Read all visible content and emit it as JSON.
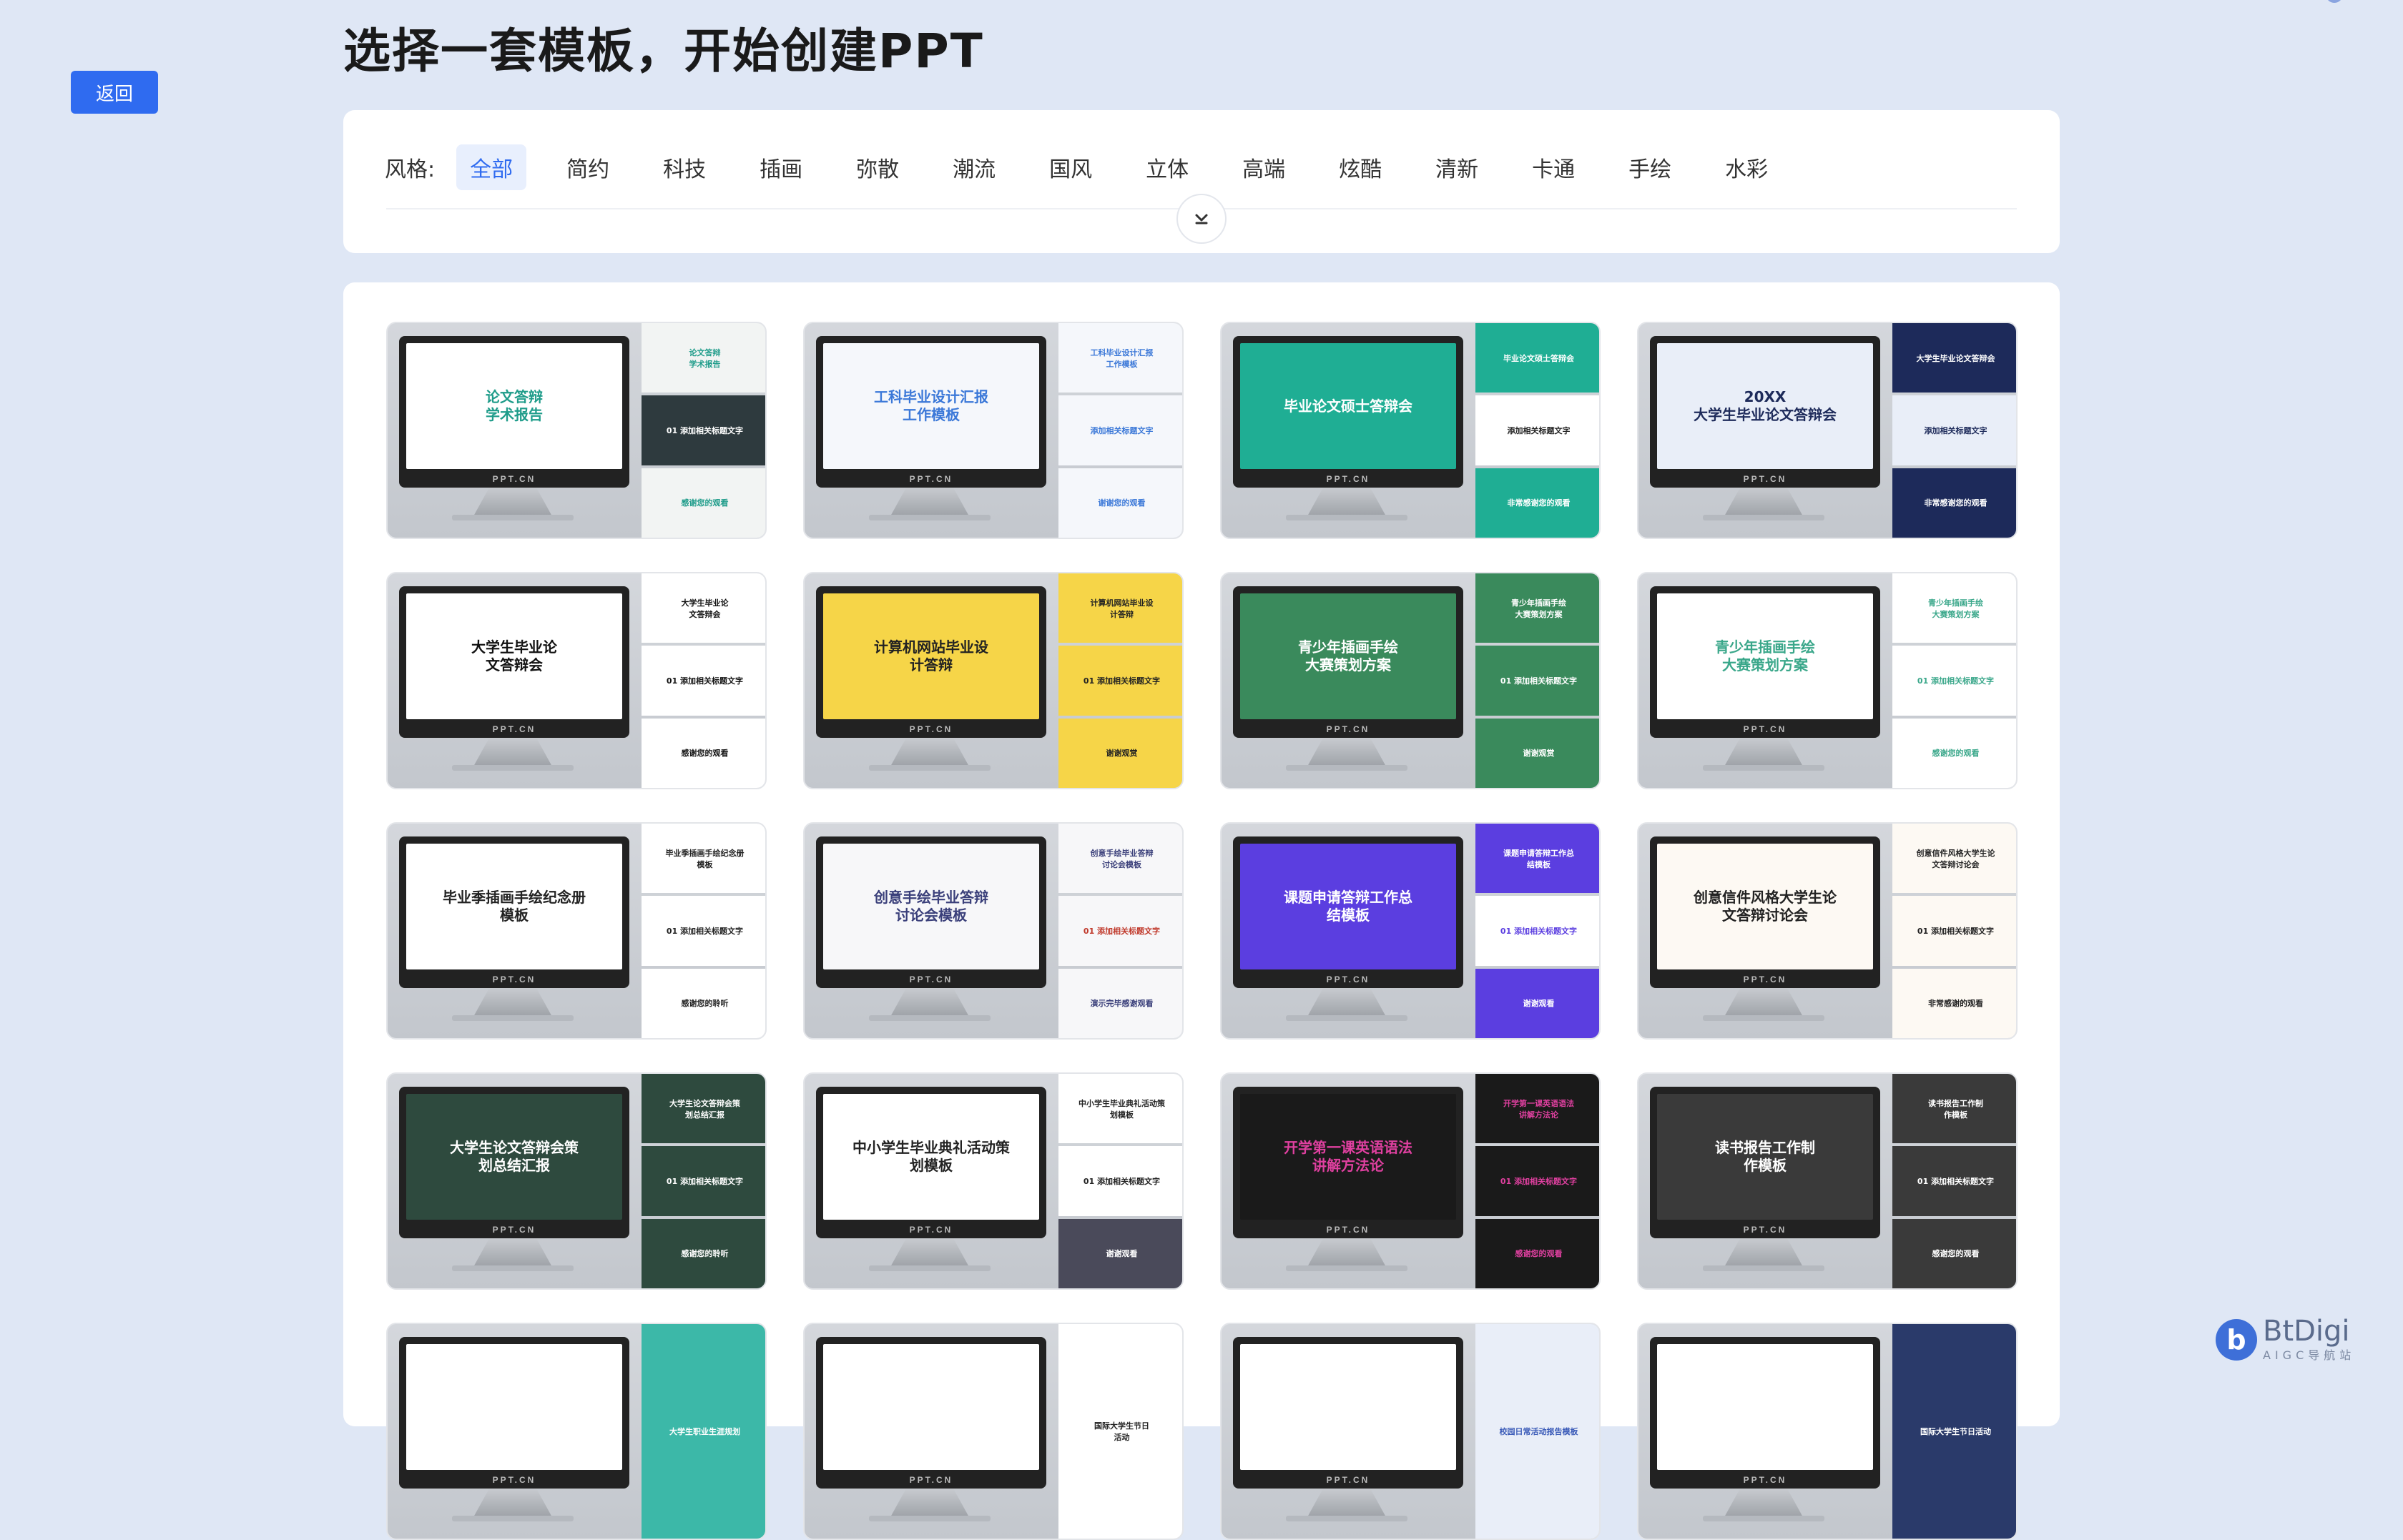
{
  "back_button": "返回",
  "page_title": "选择一套模板，开始创建PPT",
  "filter": {
    "label": "风格:",
    "active": "全部",
    "tags": [
      "全部",
      "简约",
      "科技",
      "插画",
      "弥散",
      "潮流",
      "国风",
      "立体",
      "高端",
      "炫酷",
      "清新",
      "卡通",
      "手绘",
      "水彩"
    ]
  },
  "brand_watermark": "PPT.CN",
  "templates": [
    {
      "title": "论文答辩\n学术报告",
      "bg": "#ffffff",
      "fg": "#1f9c8a",
      "side": [
        "论文答辩\n学术报告",
        "01 添加相关标题文字",
        "感谢您的观看"
      ],
      "side_bg": [
        "#f2f4f3",
        "#2e3a3e",
        "#f2f4f3"
      ],
      "side_fg": [
        "#1f9c8a",
        "#ffffff",
        "#1f9c8a"
      ]
    },
    {
      "title": "工科毕业设计汇报\n工作模板",
      "bg": "#f5f7fb",
      "fg": "#3b78d8",
      "side": [
        "工科毕业设计汇报\n工作模板",
        "添加相关标题文字",
        "谢谢您的观看"
      ],
      "side_bg": [
        "#f5f7fb",
        "#f5f7fb",
        "#f5f7fb"
      ],
      "side_fg": [
        "#3b78d8",
        "#3b78d8",
        "#3b78d8"
      ]
    },
    {
      "title": "毕业论文硕士答辩会",
      "bg": "#1fae94",
      "fg": "#ffffff",
      "side": [
        "毕业论文硕士答辩会",
        "添加相关标题文字",
        "非常感谢您的观看"
      ],
      "side_bg": [
        "#1fae94",
        "#ffffff",
        "#1fae94"
      ],
      "side_fg": [
        "#ffffff",
        "#222222",
        "#ffffff"
      ]
    },
    {
      "title": "20XX\n大学生毕业论文答辩会",
      "bg": "#e9eef8",
      "fg": "#1d2a5a",
      "side": [
        "大学生毕业论文答辩会",
        "添加相关标题文字",
        "非常感谢您的观看"
      ],
      "side_bg": [
        "#1d2a5a",
        "#e9eef8",
        "#1d2a5a"
      ],
      "side_fg": [
        "#ffffff",
        "#1d2a5a",
        "#ffffff"
      ]
    },
    {
      "title": "大学生毕业论\n文答辩会",
      "bg": "#ffffff",
      "fg": "#111111",
      "side": [
        "大学生毕业论\n文答辩会",
        "01 添加相关标题文字",
        "感谢您的观看"
      ],
      "side_bg": [
        "#ffffff",
        "#ffffff",
        "#ffffff"
      ],
      "side_fg": [
        "#111111",
        "#111111",
        "#111111"
      ]
    },
    {
      "title": "计算机网站毕业设\n计答辩",
      "bg": "#f6d548",
      "fg": "#222222",
      "side": [
        "计算机网站毕业设\n计答辩",
        "01 添加相关标题文字",
        "谢谢观赏"
      ],
      "side_bg": [
        "#f6d548",
        "#f6d548",
        "#f6d548"
      ],
      "side_fg": [
        "#222222",
        "#222222",
        "#222222"
      ]
    },
    {
      "title": "青少年插画手绘\n大赛策划方案",
      "bg": "#3a8a5c",
      "fg": "#ffffff",
      "side": [
        "青少年插画手绘\n大赛策划方案",
        "01 添加相关标题文字",
        "谢谢观赏"
      ],
      "side_bg": [
        "#3a8a5c",
        "#3a8a5c",
        "#3a8a5c"
      ],
      "side_fg": [
        "#ffffff",
        "#ffffff",
        "#ffffff"
      ]
    },
    {
      "title": "青少年插画手绘\n大赛策划方案",
      "bg": "#ffffff",
      "fg": "#3aa78a",
      "side": [
        "青少年插画手绘\n大赛策划方案",
        "01 添加相关标题文字",
        "感谢您的观看"
      ],
      "side_bg": [
        "#ffffff",
        "#ffffff",
        "#ffffff"
      ],
      "side_fg": [
        "#3aa78a",
        "#3aa78a",
        "#3aa78a"
      ]
    },
    {
      "title": "毕业季插画手绘纪念册\n模板",
      "bg": "#ffffff",
      "fg": "#222222",
      "side": [
        "毕业季插画手绘纪念册\n模板",
        "01 添加相关标题文字",
        "感谢您的聆听"
      ],
      "side_bg": [
        "#ffffff",
        "#ffffff",
        "#ffffff"
      ],
      "side_fg": [
        "#222222",
        "#222222",
        "#222222"
      ]
    },
    {
      "title": "创意手绘毕业答辩\n讨论会模板",
      "bg": "#f7f7f9",
      "fg": "#3a3f7a",
      "side": [
        "创意手绘毕业答辩\n讨论会模板",
        "01 添加相关标题文字",
        "演示完毕感谢观看"
      ],
      "side_bg": [
        "#f7f7f9",
        "#f7f7f9",
        "#f7f7f9"
      ],
      "side_fg": [
        "#3a3f7a",
        "#c0392b",
        "#3a3f7a"
      ]
    },
    {
      "title": "课题申请答辩工作总\n结模板",
      "bg": "#5b3ee0",
      "fg": "#ffffff",
      "side": [
        "课题申请答辩工作总\n结模板",
        "01 添加相关标题文字",
        "谢谢观看"
      ],
      "side_bg": [
        "#5b3ee0",
        "#ffffff",
        "#5b3ee0"
      ],
      "side_fg": [
        "#ffffff",
        "#5b3ee0",
        "#ffffff"
      ]
    },
    {
      "title": "创意信件风格大学生论\n文答辩讨论会",
      "bg": "#fdf9f3",
      "fg": "#222222",
      "side": [
        "创意信件风格大学生论\n文答辩讨论会",
        "01 添加相关标题文字",
        "非常感谢的观看"
      ],
      "side_bg": [
        "#fdf9f3",
        "#fdf9f3",
        "#fdf9f3"
      ],
      "side_fg": [
        "#222222",
        "#222222",
        "#222222"
      ]
    },
    {
      "title": "大学生论文答辩会策\n划总结汇报",
      "bg": "#2e4a3e",
      "fg": "#ffffff",
      "side": [
        "大学生论文答辩会策\n划总结汇报",
        "01 添加相关标题文字",
        "感谢您的聆听"
      ],
      "side_bg": [
        "#2e4a3e",
        "#2e4a3e",
        "#2e4a3e"
      ],
      "side_fg": [
        "#ffffff",
        "#ffffff",
        "#ffffff"
      ]
    },
    {
      "title": "中小学生毕业典礼活动策\n划模板",
      "bg": "#ffffff",
      "fg": "#222222",
      "side": [
        "中小学生毕业典礼活动策\n划模板",
        "01 添加相关标题文字",
        "谢谢观看"
      ],
      "side_bg": [
        "#ffffff",
        "#ffffff",
        "#4a4a5a"
      ],
      "side_fg": [
        "#222222",
        "#222222",
        "#ffffff"
      ]
    },
    {
      "title": "开学第一课英语语法\n讲解方法论",
      "bg": "#1a1a1a",
      "fg": "#e040a0",
      "side": [
        "开学第一课英语语法\n讲解方法论",
        "01 添加相关标题文字",
        "感谢您的观看"
      ],
      "side_bg": [
        "#1a1a1a",
        "#1a1a1a",
        "#1a1a1a"
      ],
      "side_fg": [
        "#e040a0",
        "#e040a0",
        "#e040a0"
      ]
    },
    {
      "title": "读书报告工作制\n作模板",
      "bg": "#3a3a3a",
      "fg": "#ffffff",
      "side": [
        "读书报告工作制\n作模板",
        "01 添加相关标题文字",
        "感谢您的观看"
      ],
      "side_bg": [
        "#3a3a3a",
        "#3a3a3a",
        "#3a3a3a"
      ],
      "side_fg": [
        "#ffffff",
        "#ffffff",
        "#ffffff"
      ]
    },
    {
      "title": "",
      "bg": "#ffffff",
      "fg": "#222222",
      "side": [
        "大学生职业生涯规划"
      ],
      "side_bg": [
        "#3cb8a8"
      ],
      "side_fg": [
        "#ffffff"
      ]
    },
    {
      "title": "",
      "bg": "#ffffff",
      "fg": "#222222",
      "side": [
        "国际大学生节日\n活动"
      ],
      "side_bg": [
        "#ffffff"
      ],
      "side_fg": [
        "#222222"
      ]
    },
    {
      "title": "",
      "bg": "#ffffff",
      "fg": "#222222",
      "side": [
        "校园日常活动报告模板"
      ],
      "side_bg": [
        "#e9eef8"
      ],
      "side_fg": [
        "#3b5bb8"
      ]
    },
    {
      "title": "",
      "bg": "#ffffff",
      "fg": "#222222",
      "side": [
        "国际大学生节日活动"
      ],
      "side_bg": [
        "#2a3a6a"
      ],
      "side_fg": [
        "#ffffff"
      ]
    }
  ],
  "watermark": {
    "name": "BtDigi",
    "sub": "AIGC导航站",
    "logo": "b"
  }
}
